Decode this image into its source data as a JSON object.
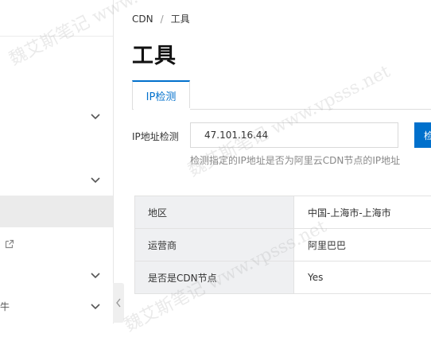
{
  "breadcrumb": {
    "root": "CDN",
    "separator": "/",
    "current": "工具"
  },
  "page": {
    "title": "工具"
  },
  "tabs": [
    {
      "label": "IP检测",
      "active": true
    }
  ],
  "ip_check": {
    "label": "IP地址检测",
    "value": "47.101.16.44",
    "button_label": "检测",
    "hint": "检测指定的IP地址是否为阿里云CDN节点的IP地址"
  },
  "result_rows": [
    {
      "key": "地区",
      "value": "中国-上海市-上海市"
    },
    {
      "key": "运营商",
      "value": "阿里巴巴"
    },
    {
      "key": "是否是CDN节点",
      "value": "Yes"
    }
  ],
  "sidebar": {
    "partial_label": "牛"
  },
  "watermark": {
    "text_cn": "魏艾斯笔记",
    "text_en": "www.vpsss.net"
  },
  "colors": {
    "accent": "#0070cc",
    "key_cell_bg": "#eff0f2",
    "sidebar_active": "#ebebeb"
  },
  "icons": [
    "chevron-down-icon",
    "external-link-icon",
    "chevron-left-icon"
  ]
}
